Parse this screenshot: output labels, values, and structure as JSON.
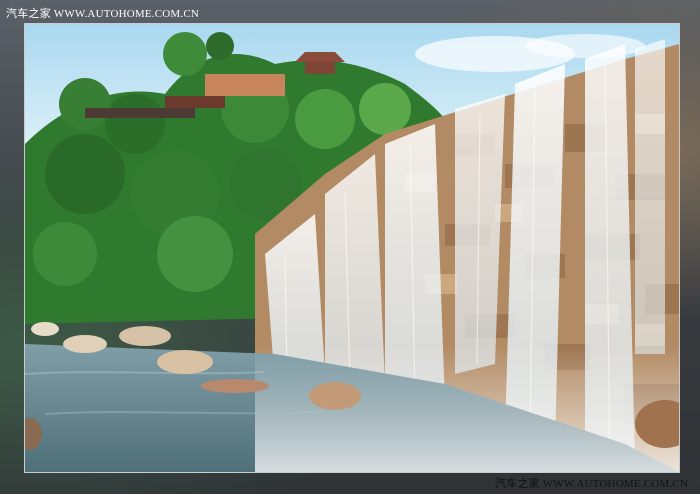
{
  "watermark_top": "汽车之家  WWW.AUTOHOME.COM.CN",
  "watermark_bottom": "汽车之家  WWW.AUTOHOME.COM.CN",
  "photo": {
    "subject": "waterfall",
    "colors": {
      "sky": "#bfe3f3",
      "foliage": "#2f7a2e",
      "rock": "#b28a63",
      "water": "#eef6fb",
      "pool": "#6f8f9a",
      "roof": "#8a4b3a"
    }
  }
}
